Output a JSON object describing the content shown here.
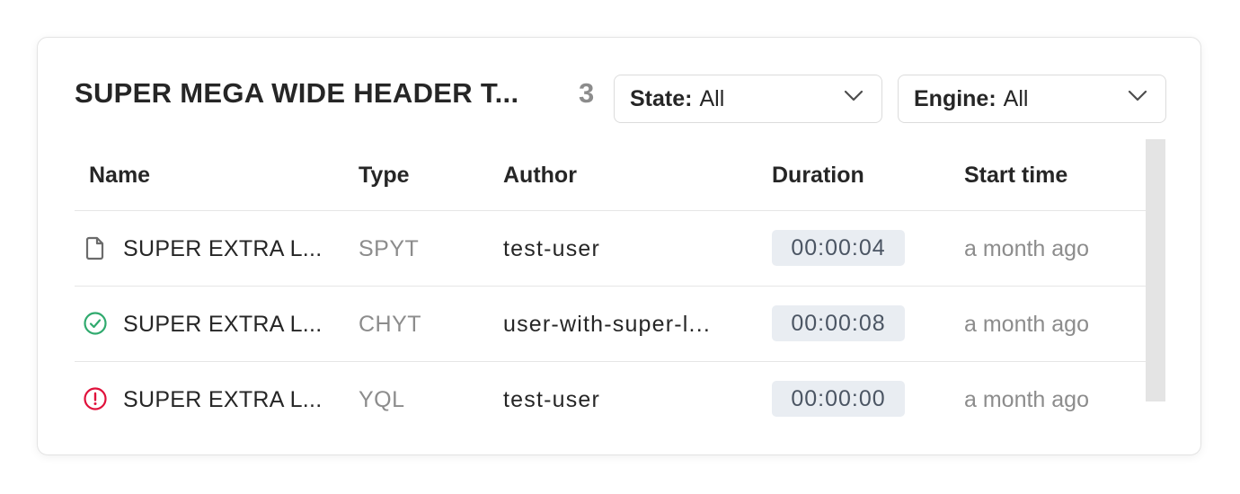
{
  "header": {
    "title": "SUPER MEGA WIDE HEADER T...",
    "count": "3"
  },
  "filters": {
    "state": {
      "label": "State:",
      "value": "All",
      "icon": "chevron-down-icon"
    },
    "engine": {
      "label": "Engine:",
      "value": "All",
      "icon": "chevron-down-icon"
    }
  },
  "table": {
    "columns": [
      "Name",
      "Type",
      "Author",
      "Duration",
      "Start time"
    ],
    "rows": [
      {
        "status_icon": "file-icon",
        "name": "SUPER EXTRA L...",
        "type": "SPYT",
        "author": "test-user",
        "duration": "00:00:04",
        "start": "a month ago"
      },
      {
        "status_icon": "check-circle-icon",
        "name": "SUPER EXTRA L...",
        "type": "CHYT",
        "author": "user-with-super-l...",
        "duration": "00:00:08",
        "start": "a month ago"
      },
      {
        "status_icon": "error-circle-icon",
        "name": "SUPER EXTRA L...",
        "type": "YQL",
        "author": "test-user",
        "duration": "00:00:00",
        "start": "a month ago"
      }
    ]
  },
  "colors": {
    "success": "#30aa6e",
    "danger": "#e0113b",
    "muted": "#8c8c8c",
    "duration_bg": "#e9edf2"
  }
}
